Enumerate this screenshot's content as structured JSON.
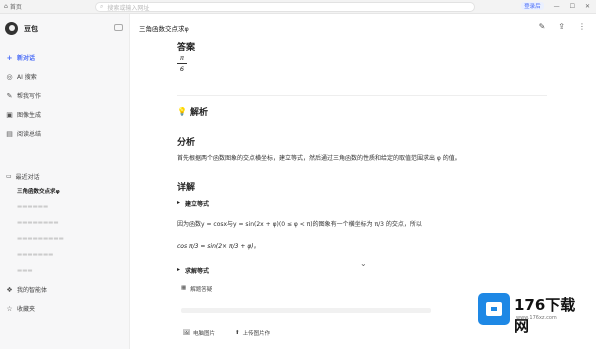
{
  "topbar": {
    "home_label": "首页",
    "search_placeholder": "搜索或输入网址",
    "login_label": "登录后",
    "icons": [
      "home-icon",
      "search-icon",
      "login-icon",
      "minimize-icon",
      "maximize-icon",
      "close-icon"
    ]
  },
  "sidebar": {
    "username": "豆包",
    "nav": [
      {
        "label": "新对话",
        "icon": "plus-icon"
      },
      {
        "label": "AI 搜索",
        "icon": "ai-search-icon"
      },
      {
        "label": "帮我写作",
        "icon": "write-icon"
      },
      {
        "label": "图像生成",
        "icon": "image-icon"
      },
      {
        "label": "阅读总结",
        "icon": "read-icon"
      }
    ],
    "recent_title": "最近对话",
    "recent": [
      "三角函数交点求φ",
      "",
      "",
      "",
      "",
      ""
    ],
    "bottom": [
      {
        "label": "我的智能体",
        "icon": "agent-icon"
      },
      {
        "label": "收藏夹",
        "icon": "favorite-icon"
      }
    ]
  },
  "main": {
    "title": "三角函数交点求φ",
    "answer_heading": "答案",
    "answer_num": "π",
    "answer_den": "6",
    "jiexi_heading": "解析",
    "fenxi_heading": "分析",
    "fenxi_text": "首先根据两个函数图象的交点横坐标，建立等式，然后通过三角函数的性质和给定的取值范围求出 φ 的值。",
    "xiangjie_heading": "详解",
    "step1_title": "建立等式",
    "step1_text": "因为函数y = cosx与y = sin(2x + φ)(0 ≤ φ < π)的图象有一个横坐标为 π/3 的交点，所以",
    "equation": "cos π/3 = sin(2× π/3 + φ)。",
    "step2_title": "求解等式",
    "grade_label": "解题答疑",
    "actions": [
      "电脑图片",
      "上传图片作"
    ]
  },
  "watermark": {
    "brand": "176下载网",
    "url": "www.176xz.com"
  }
}
